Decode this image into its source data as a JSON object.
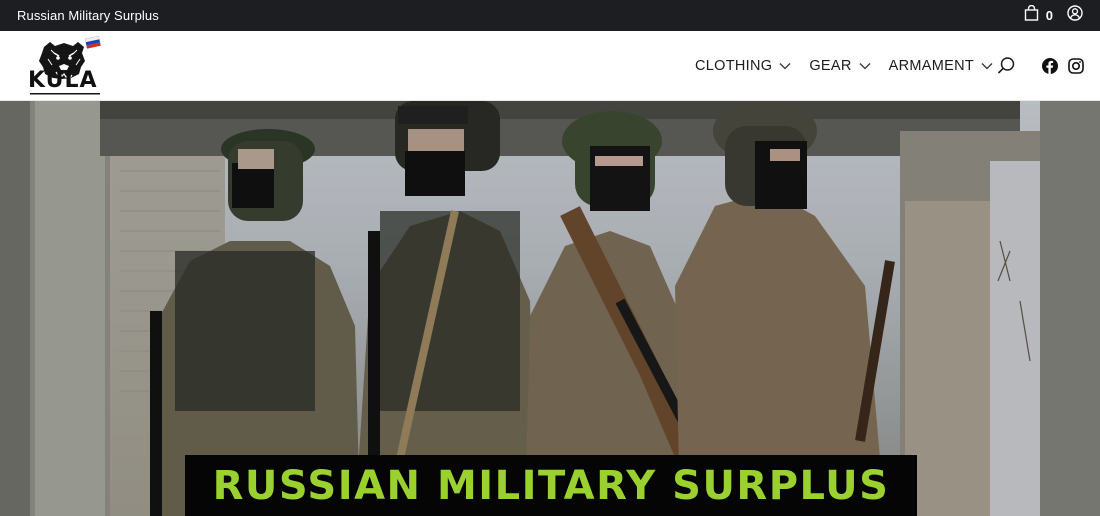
{
  "topbar": {
    "store_name": "Russian Military Surplus",
    "cart_count": "0",
    "cart_icon": "shopping-bag-icon",
    "account_icon": "user-circle-icon"
  },
  "header": {
    "logo_text": "KULA",
    "logo_icon": "bear-head-icon",
    "flag": "russian-flag",
    "nav": [
      {
        "label": "CLOTHING",
        "icon": "chevron-down-icon"
      },
      {
        "label": "GEAR",
        "icon": "chevron-down-icon"
      },
      {
        "label": "ARMAMENT",
        "icon": "chevron-down-icon"
      }
    ],
    "search_icon": "search-icon",
    "social": [
      "facebook-icon",
      "instagram-icon"
    ]
  },
  "hero": {
    "banner_text": "RUSSIAN MILITARY SURPLUS"
  },
  "colors": {
    "topbar_bg": "#1c1e21",
    "banner_bg": "#050505",
    "banner_text": "#9ad12e"
  }
}
